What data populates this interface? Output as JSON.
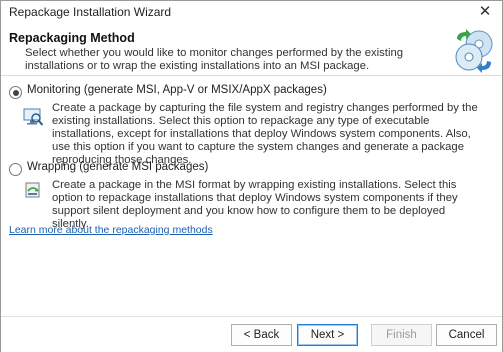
{
  "window": {
    "title": "Repackage Installation Wizard",
    "close_glyph": "✕"
  },
  "header": {
    "title": "Repackaging Method",
    "description": "Select whether you would like to monitor changes performed by the existing installations or to wrap the existing installations into an MSI package.",
    "icon": "discs-cycle-icon"
  },
  "options": [
    {
      "label": "Monitoring (generate MSI, App-V or MSIX/AppX packages)",
      "description": "Create a package by capturing the file system and registry changes performed by the existing installations. Select this option to repackage any type of executable installations, except for installations that deploy Windows system components. Also, use this option if you want to capture the system changes and generate a package reproducing those changes.",
      "selected": true,
      "icon": "monitor-magnifier-icon"
    },
    {
      "label": "Wrapping (generate MSI packages)",
      "description": "Create a package in the MSI format by wrapping existing installations. Select this option to repackage installations that deploy Windows system components if they support silent deployment and you know how to configure them to be deployed silently.",
      "selected": false,
      "icon": "package-wrap-icon"
    }
  ],
  "link": {
    "text": "Learn more about the repackaging methods"
  },
  "buttons": {
    "back": "< Back",
    "next": "Next >",
    "finish": "Finish",
    "cancel": "Cancel"
  },
  "colors": {
    "link": "#1a5fb4",
    "accent": "#2a7bd4"
  }
}
